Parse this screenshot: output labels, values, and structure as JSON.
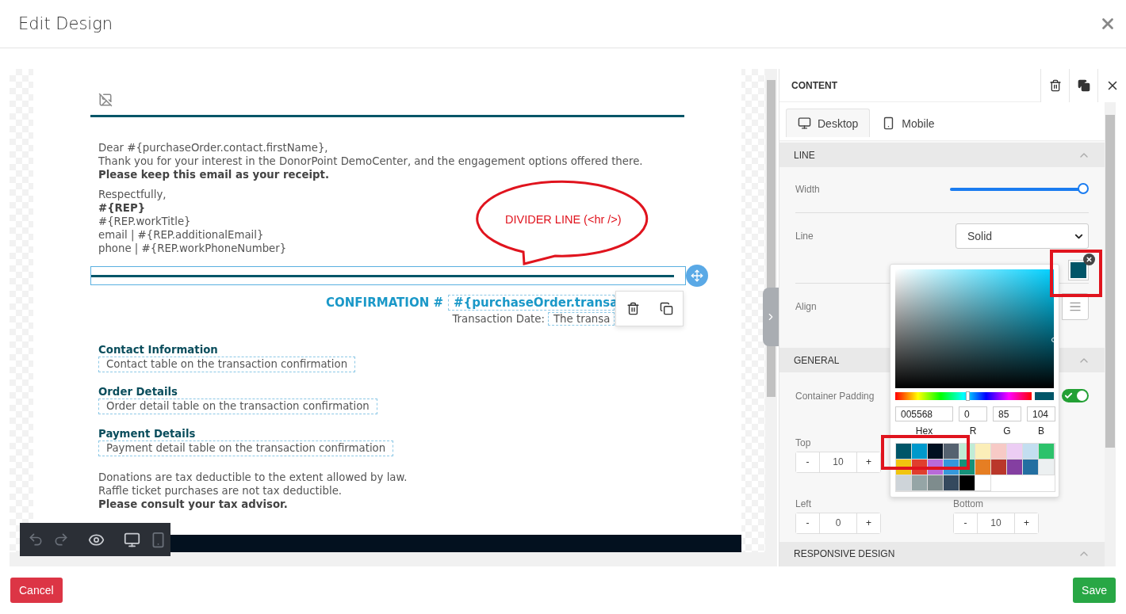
{
  "dialog": {
    "title": "Edit Design"
  },
  "email": {
    "greeting": [
      {
        "text": "Dear #{purchaseOrder.contact.firstName},",
        "bold": false
      },
      {
        "text": "Thank you for your interest in the DonorPoint DemoCenter, and the engagement options offered there.",
        "bold": false
      },
      {
        "text": "Please keep this email as your receipt.",
        "bold": true
      }
    ],
    "signature": [
      {
        "text": "Respectfully,",
        "bold": false
      },
      {
        "text": "#{REP}",
        "bold": true
      },
      {
        "text": "#{REP.workTitle}",
        "bold": false
      },
      {
        "text": "email | #{REP.additionalEmail}",
        "bold": false
      },
      {
        "text": "phone | #{REP.workPhoneNumber}",
        "bold": false
      }
    ],
    "confirmation": {
      "label": "CONFIRMATION #",
      "value": "#{purchaseOrder.transa",
      "date_label": "Transaction Date:",
      "date_value": "The transa"
    },
    "sections": [
      {
        "heading": "Contact Information",
        "merge_field": "Contact table on the transaction confirmation"
      },
      {
        "heading": "Order Details",
        "merge_field": "Order detail table on the transaction confirmation"
      },
      {
        "heading": "Payment Details",
        "merge_field": "Payment detail table on the transaction confirmation"
      }
    ],
    "disclaimer": [
      {
        "text": "Donations are tax deductible to the extent allowed by law.",
        "bold": false
      },
      {
        "text": "Raffle ticket purchases are not tax deductible.",
        "bold": false
      },
      {
        "text": "Please consult your tax advisor.",
        "bold": true
      }
    ]
  },
  "annotation": {
    "text": "DIVIDER LINE (<hr />)"
  },
  "panel": {
    "title": "CONTENT",
    "tabs": [
      {
        "label": "Desktop",
        "kind": "desktop",
        "selected": true
      },
      {
        "label": "Mobile",
        "kind": "mobile",
        "selected": false
      }
    ],
    "line_section": {
      "title": "LINE",
      "expanded": true,
      "width_label": "Width",
      "width": {
        "level": 1
      },
      "line_label": "Line",
      "line_style": "Solid",
      "align_label": "Align"
    },
    "general_section": {
      "title": "GENERAL",
      "expanded": true,
      "padding_label": "Container Padding",
      "padding_on": true,
      "minus": "-",
      "plus": "+",
      "fields": [
        {
          "label": "Top",
          "value": "10"
        },
        {
          "label": "Left",
          "value": "0"
        },
        {
          "label": "Bottom",
          "value": "10"
        }
      ]
    },
    "responsive_section": {
      "title": "RESPONSIVE DESIGN",
      "expanded": true
    }
  },
  "color_picker": {
    "hex": "005568",
    "r": "0",
    "g": "85",
    "b": "104",
    "hue": {
      "level": 0.53
    },
    "labels": [
      "Hex",
      "R",
      "G",
      "B"
    ],
    "swatches": [
      {
        "color": "#005568"
      },
      {
        "color": "#0099cc"
      },
      {
        "color": "#001020"
      },
      {
        "color": "#556270"
      },
      {
        "color": "#c0ecd5"
      },
      {
        "color": "#fbeeb8"
      },
      {
        "color": "#f7cac6"
      },
      {
        "color": "#eccdf4"
      },
      {
        "color": "#c3def0"
      },
      {
        "color": "#2dc26b"
      },
      {
        "color": "#f1c40f"
      },
      {
        "color": "#e03e2d"
      },
      {
        "color": "#b96ad9"
      },
      {
        "color": "#3598db"
      },
      {
        "color": "#169179"
      },
      {
        "color": "#e67e23"
      },
      {
        "color": "#ba372a"
      },
      {
        "color": "#843fa1"
      },
      {
        "color": "#236fa1"
      },
      {
        "color": "#ecf0f1"
      },
      {
        "color": "#ced4d9"
      },
      {
        "color": "#95a5a6"
      },
      {
        "color": "#7e8c8d"
      },
      {
        "color": "#34495e"
      },
      {
        "color": "#000000"
      },
      {
        "color": "#ffffff"
      }
    ]
  },
  "footer": {
    "cancel": "Cancel",
    "save": "Save"
  }
}
